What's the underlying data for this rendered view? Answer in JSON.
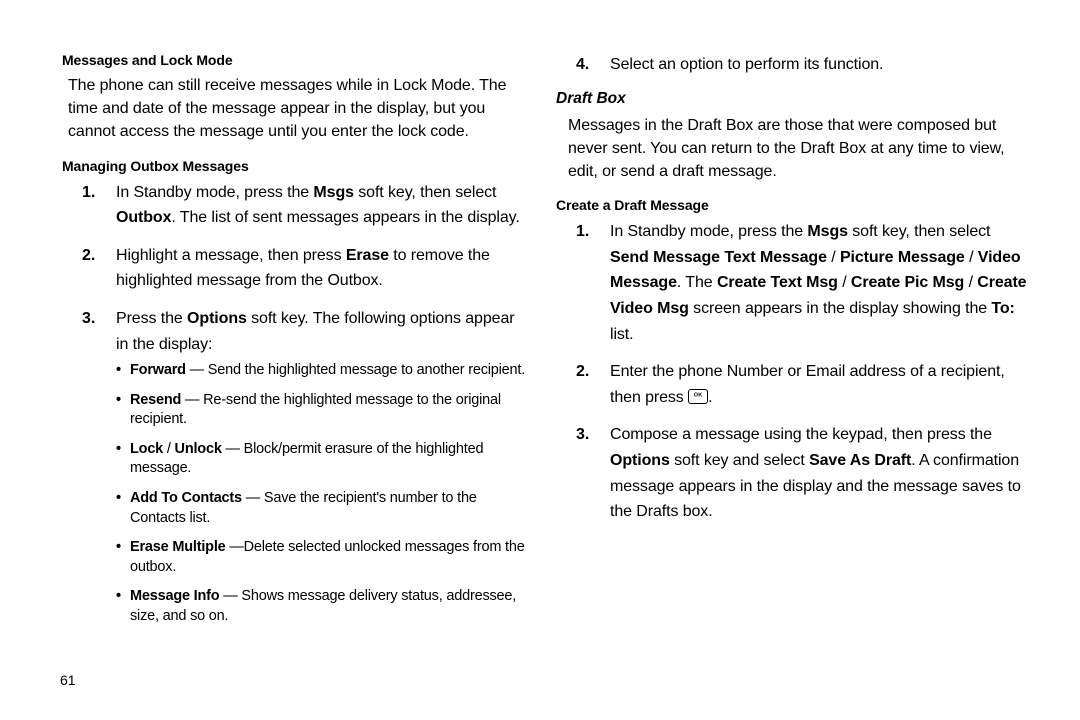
{
  "page_number": "61",
  "left": {
    "h1": "Messages and Lock Mode",
    "p1": "The phone can still receive messages while in Lock Mode. The time and date of the message appear in the display, but you cannot access the message until you enter the lock code.",
    "h2": "Managing Outbox Messages",
    "steps": [
      [
        {
          "t": "In Standby mode, press the "
        },
        {
          "t": "Msgs",
          "b": true
        },
        {
          "t": " soft key, then select "
        },
        {
          "t": "Outbox",
          "b": true
        },
        {
          "t": ". The list of sent messages appears in the display."
        }
      ],
      [
        {
          "t": "Highlight a message, then press "
        },
        {
          "t": "Erase",
          "b": true
        },
        {
          "t": " to remove the highlighted message from the Outbox."
        }
      ],
      [
        {
          "t": "Press the "
        },
        {
          "t": "Options",
          "b": true
        },
        {
          "t": " soft key. The following options appear in the display:"
        }
      ]
    ],
    "bullets": [
      [
        {
          "t": "Forward",
          "b": true
        },
        {
          "t": " — Send the highlighted message to another recipient."
        }
      ],
      [
        {
          "t": "Resend",
          "b": true
        },
        {
          "t": " — Re-send the highlighted message to the original recipient."
        }
      ],
      [
        {
          "t": "Lock",
          "b": true
        },
        {
          "t": " / "
        },
        {
          "t": "Unlock",
          "b": true
        },
        {
          "t": " — Block/permit erasure of the highlighted message."
        }
      ],
      [
        {
          "t": "Add To Contacts",
          "b": true
        },
        {
          "t": " — Save the recipient's number to the Contacts list."
        }
      ],
      [
        {
          "t": "Erase Multiple",
          "b": true
        },
        {
          "t": " —Delete selected unlocked messages from the outbox."
        }
      ],
      [
        {
          "t": "Message Info",
          "b": true
        },
        {
          "t": " — Shows message delivery status, addressee, size, and so on."
        }
      ]
    ]
  },
  "right": {
    "step4": [
      {
        "t": "Select an option to perform its function."
      }
    ],
    "section": "Draft Box",
    "intro": "Messages in the Draft Box are those that were composed but never sent. You can return to the Draft Box at any time to view, edit, or send a draft message.",
    "h3": "Create a Draft Message",
    "steps": [
      [
        {
          "t": "In Standby mode, press the "
        },
        {
          "t": "Msgs",
          "b": true
        },
        {
          "t": " soft key, then select "
        },
        {
          "t": "Send Message",
          "b": true
        },
        {
          "t": " "
        },
        {
          "t": "Text Message",
          "b": true
        },
        {
          "t": " / "
        },
        {
          "t": "Picture Message",
          "b": true
        },
        {
          "t": " / "
        },
        {
          "t": "Video Message",
          "b": true
        },
        {
          "t": ". The "
        },
        {
          "t": "Create Text Msg",
          "b": true
        },
        {
          "t": " / "
        },
        {
          "t": "Create Pic Msg",
          "b": true
        },
        {
          "t": " / "
        },
        {
          "t": "Create Video Msg",
          "b": true
        },
        {
          "t": " screen appears in the display showing the "
        },
        {
          "t": "To:",
          "b": true
        },
        {
          "t": " list."
        }
      ],
      [
        {
          "t": "Enter the phone Number or Email address of a recipient, then press "
        },
        {
          "key": "ok"
        },
        {
          "t": "."
        }
      ],
      [
        {
          "t": "Compose a message using the keypad, then press the "
        },
        {
          "t": "Options",
          "b": true
        },
        {
          "t": " soft key and select "
        },
        {
          "t": "Save As Draft",
          "b": true
        },
        {
          "t": ". A confirmation message appears in the display and the message saves to the Drafts box."
        }
      ]
    ]
  }
}
